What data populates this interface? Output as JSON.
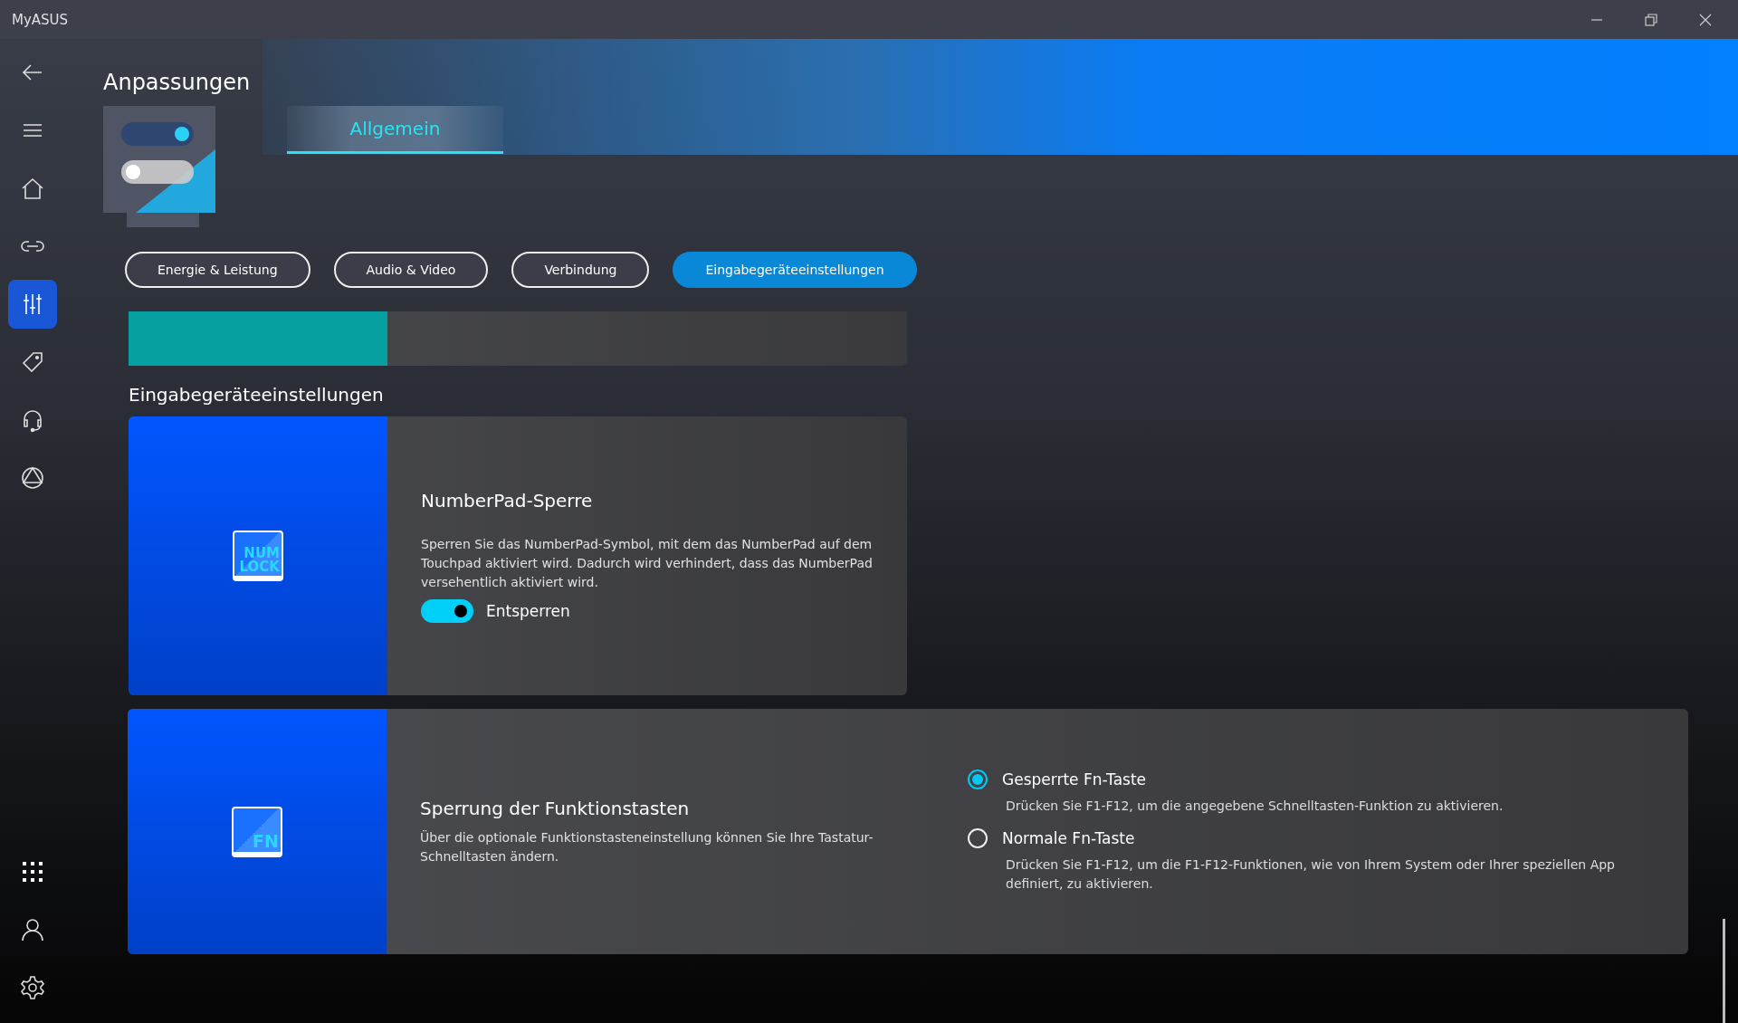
{
  "window": {
    "title": "MyASUS"
  },
  "sidebar": {
    "items": [
      {
        "kind": "home",
        "selected": false
      },
      {
        "kind": "link",
        "selected": false
      },
      {
        "kind": "sliders",
        "selected": true
      },
      {
        "kind": "tag",
        "selected": false
      },
      {
        "kind": "headset",
        "selected": false
      },
      {
        "kind": "triangle",
        "selected": false
      }
    ],
    "bottom_items": [
      {
        "kind": "apps"
      },
      {
        "kind": "user"
      },
      {
        "kind": "settings"
      }
    ]
  },
  "page": {
    "title": "Anpassungen"
  },
  "tabs": [
    {
      "label": "Allgemein",
      "selected": true
    }
  ],
  "categories": [
    {
      "label": "Energie & Leistung",
      "selected": false
    },
    {
      "label": "Audio & Video",
      "selected": false
    },
    {
      "label": "Verbindung",
      "selected": false
    },
    {
      "label": "Eingabegeräteeinstellungen",
      "selected": true
    }
  ],
  "section": {
    "title": "Eingabegeräteeinstellungen"
  },
  "settings": [
    {
      "kind": "toggle",
      "icon_text": [
        "NUM",
        "LOCK"
      ],
      "title": "NumberPad-Sperre",
      "description": "Sperren Sie das NumberPad-Symbol, mit dem das NumberPad auf dem Touchpad aktiviert wird. Dadurch wird verhindert, dass das NumberPad versehentlich aktiviert wird.",
      "toggle": {
        "on": true,
        "label": "Entsperren"
      }
    },
    {
      "kind": "radio",
      "icon_text": [
        "FN"
      ],
      "title": "Sperrung der Funktionstasten",
      "description": "Über die optionale Funktionstasteneinstellung können Sie Ihre Tastatur-Schnelltasten ändern.",
      "options": [
        {
          "label": "Gesperrte Fn-Taste",
          "description": "Drücken Sie F1-F12, um die angegebene Schnelltasten-Funktion zu aktivieren.",
          "selected": true
        },
        {
          "label": "Normale Fn-Taste",
          "description": "Drücken Sie F1-F12, um die F1-F12-Funktionen, wie von Ihrem System oder Ihrer speziellen App definiert, zu aktivieren.",
          "selected": false
        }
      ]
    }
  ]
}
